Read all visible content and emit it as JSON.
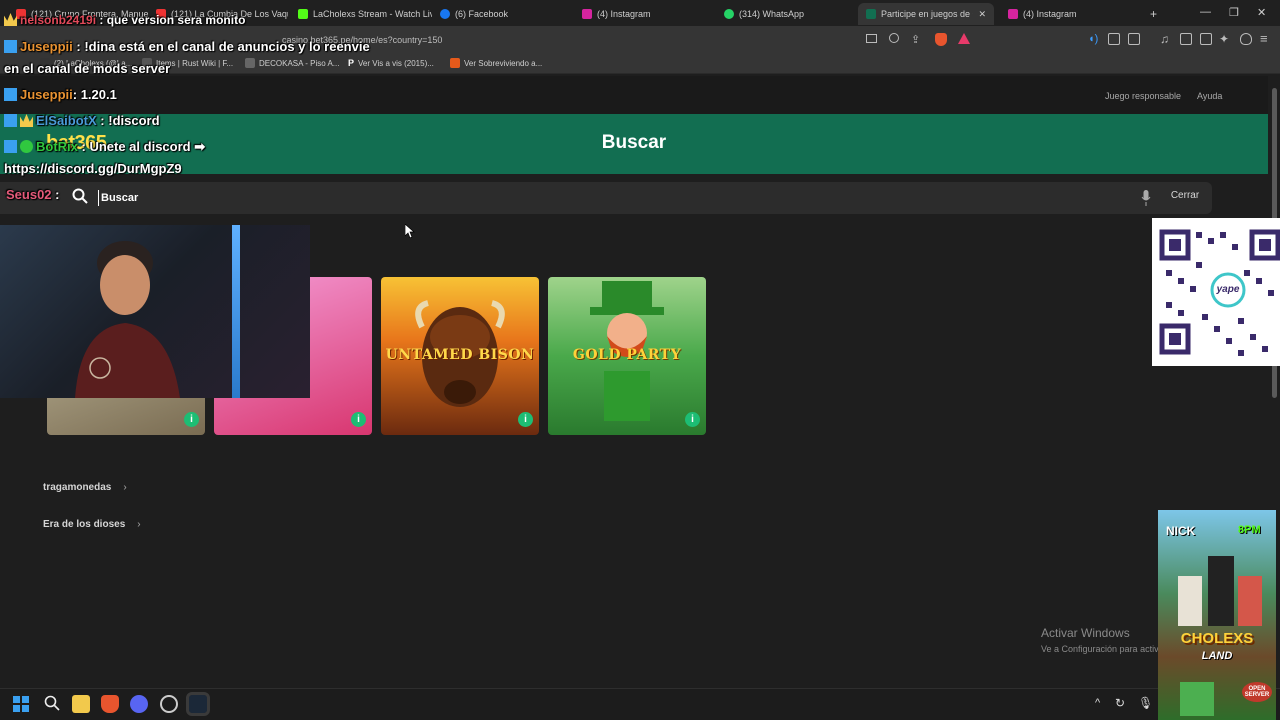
{
  "browser": {
    "tabs": [
      {
        "label": "(121) Grupo Frontera, Manuel",
        "color": "#e33"
      },
      {
        "label": "(121) La Cumbia De Los Vaqu",
        "color": "#e33"
      },
      {
        "label": "LaCholexs Stream - Watch Live",
        "color": "#53fc18"
      },
      {
        "label": "(6) Facebook",
        "color": "#1877f2"
      },
      {
        "label": "(4) Instagram",
        "color": "#d6249f"
      },
      {
        "label": "(314) WhatsApp",
        "color": "#25d366"
      },
      {
        "label": "Participe en juegos de Ca",
        "color": "#126e51"
      },
      {
        "label": "(4) Instagram",
        "color": "#d6249f"
      }
    ],
    "new_tab": "+",
    "url": "casino.bet365.pe/home/es?country=150",
    "bookmarks": [
      {
        "label": "(2) LaCholexs (@La...",
        "color": "#333"
      },
      {
        "label": "Items | Rust Wiki | F...",
        "color": "#555"
      },
      {
        "label": "DECOKASA - Piso A...",
        "color": "#666"
      },
      {
        "label": "Ver Vis a vis (2015)...",
        "color": "#000"
      },
      {
        "label": "Ver Sobreviviendo a...",
        "color": "#e55a1b"
      }
    ]
  },
  "site": {
    "top_links": {
      "responsible": "Juego responsable",
      "help": "Ayuda"
    },
    "logo": "bet365",
    "header_title": "Buscar",
    "search": {
      "placeholder": "Buscar",
      "value": ""
    },
    "close_label": "Cerrar",
    "games": [
      {
        "name": "",
        "bg": "linear-gradient(160deg,#c9c2a5,#7a6c52)",
        "text_color": "#fff"
      },
      {
        "name": "",
        "bg": "linear-gradient(160deg,#f49ad4,#d8366f)",
        "text_color": "#fff"
      },
      {
        "name": "UNTAMED BISON",
        "bg": "linear-gradient(180deg,#f7c235 0%,#e8761b 40%,#6b2a0f 100%)",
        "text_color": "#ffd84a"
      },
      {
        "name": "GOLD PARTY",
        "bg": "linear-gradient(180deg,#9fd38b 0%,#4aa94b 50%,#2a7a2e 100%)",
        "text_color": "#ffd23a"
      }
    ],
    "categories": [
      "tragamonedas",
      "Era de los dioses"
    ]
  },
  "windows": {
    "activate_title": "Activar Windows",
    "activate_sub": "Ve a Configuración para activar Windows."
  },
  "chat": [
    {
      "user": "nelsonb2419i",
      "text": "que version sera monito",
      "user_color": "#e24a5a",
      "badge": "crown"
    },
    {
      "user": "Juseppii",
      "text": "!dina está en el canal de anuncios y lo reenvie",
      "user_color": "#e89232",
      "badge": "x"
    },
    {
      "user": "",
      "text": "en el canal de mods server",
      "user_color": "#fff",
      "badge": ""
    },
    {
      "user": "Juseppii",
      "text": "1.20.1",
      "user_color": "#e89232",
      "badge": "x"
    },
    {
      "user": "ElSaibotX",
      "text": "!discord",
      "user_color": "#4a9bd8",
      "badge": "x"
    },
    {
      "user": "BotRix",
      "text": "Unete al discord ➡",
      "user_color": "#30c83f",
      "badge": "x"
    },
    {
      "user": "",
      "text": "https://discord.gg/DurMgpZ9",
      "user_color": "#fff",
      "badge": ""
    },
    {
      "user": "Seus02",
      "text": "",
      "user_color": "#e55a7a",
      "badge": ""
    }
  ],
  "overlay": {
    "qr_brand": "yape",
    "promo_top_left": "NICK",
    "promo_top_right": "8PM",
    "promo_title": "CHOLEXS",
    "promo_sub": "LAND",
    "promo_badge": "OPEN SERVER"
  }
}
